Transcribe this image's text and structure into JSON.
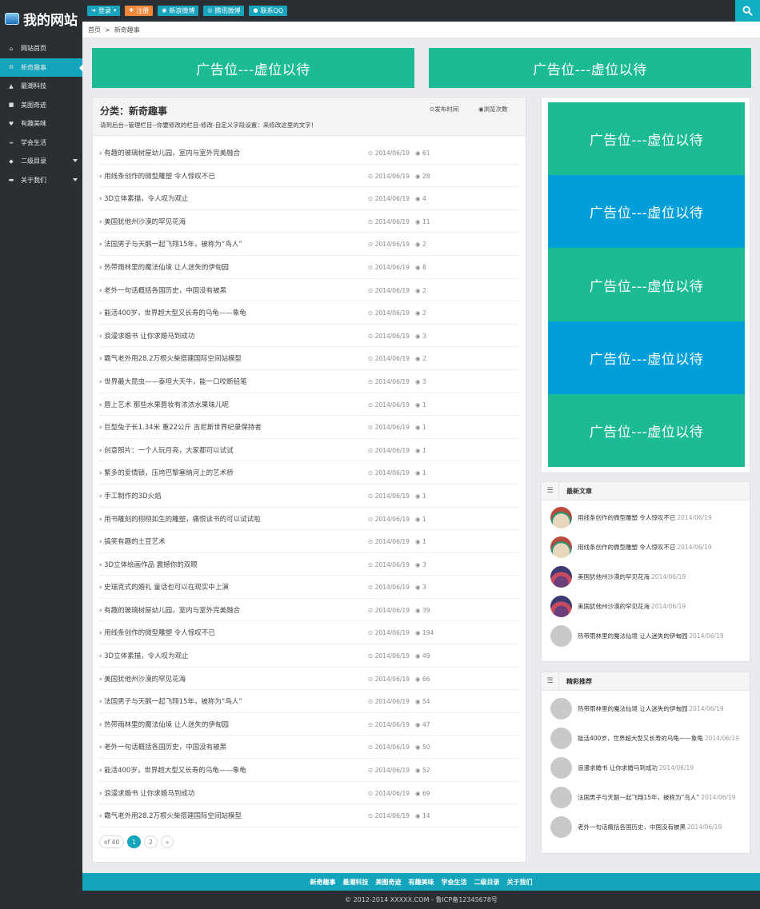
{
  "site": {
    "title": "我的网站"
  },
  "topbar": {
    "buttons": [
      {
        "label": "登录",
        "icon": "login-icon"
      },
      {
        "label": "注册",
        "icon": "user-icon"
      },
      {
        "label": "新浪微博",
        "icon": "weibo-icon"
      },
      {
        "label": "腾讯微博",
        "icon": "tencent-weibo-icon"
      },
      {
        "label": "联系QQ",
        "icon": "chat-icon"
      }
    ]
  },
  "sidebar": {
    "items": [
      {
        "label": "网站首页",
        "icon": "home-icon"
      },
      {
        "label": "新奇趣事",
        "icon": "gear-icon"
      },
      {
        "label": "最潮科技",
        "icon": "flask-icon"
      },
      {
        "label": "美图奇迹",
        "icon": "camera-icon"
      },
      {
        "label": "有趣美味",
        "icon": "thumbs-up-icon"
      },
      {
        "label": "学会生活",
        "icon": "coffee-icon"
      },
      {
        "label": "二级目录",
        "icon": "diamond-icon"
      },
      {
        "label": "关于我们",
        "icon": "folder-icon"
      }
    ]
  },
  "breadcrumb": {
    "home": "首页",
    "sep": ">",
    "current": "新奇趣事"
  },
  "ads": {
    "label": "广告位---虚位以待"
  },
  "category": {
    "title": "分类：新奇趣事",
    "desc": "请到后台--管理栏目--你要修改的栏目-修改-自定义字段设置：来修改这里的文字！",
    "sort_time": "发布时间",
    "sort_views": "浏览次数"
  },
  "articles": [
    {
      "title": "有趣的玻璃树屋幼儿园，室内与室外完美融合",
      "date": "2014/06/19",
      "views": "61"
    },
    {
      "title": "用线条创作的微型雕塑 令人惊叹不已",
      "date": "2014/06/19",
      "views": "28"
    },
    {
      "title": "3D立体素描，令人叹为观止",
      "date": "2014/06/19",
      "views": "4"
    },
    {
      "title": "美国犹他州沙漠的罕见花海",
      "date": "2014/06/19",
      "views": "11"
    },
    {
      "title": "法国男子与天鹅一起飞翔15年，被称为“鸟人”",
      "date": "2014/06/19",
      "views": "2"
    },
    {
      "title": "热带雨林里的魔法仙境 让人迷失的伊甸园",
      "date": "2014/06/19",
      "views": "8"
    },
    {
      "title": "老外一句话概括各国历史，中国没有被黑",
      "date": "2014/06/19",
      "views": "2"
    },
    {
      "title": "能活400岁，世界超大型又长寿的乌龟——象龟",
      "date": "2014/06/19",
      "views": "2"
    },
    {
      "title": "浪漫求婚书 让你求婚马到成功",
      "date": "2014/06/19",
      "views": "3"
    },
    {
      "title": "霸气老外用28.2万根火柴搭建国际空间站模型",
      "date": "2014/06/19",
      "views": "2"
    },
    {
      "title": "世界最大昆虫——泰坦大天牛，能一口咬断铅笔",
      "date": "2014/06/19",
      "views": "3"
    },
    {
      "title": "唇上艺术 那些水果唇妆有浓浓水果味儿呢",
      "date": "2014/06/19",
      "views": "1"
    },
    {
      "title": "巨型兔子长1.34米 重22公斤 吉尼斯世界纪录保持者",
      "date": "2014/06/19",
      "views": "1"
    },
    {
      "title": "创意照片：一个人玩月亮，大家都可以试试",
      "date": "2014/06/19",
      "views": "1"
    },
    {
      "title": "繁多的爱情锁，压垮巴黎塞纳河上的艺术桥",
      "date": "2014/06/19",
      "views": "1"
    },
    {
      "title": "手工制作的3D火焰",
      "date": "2014/06/19",
      "views": "1"
    },
    {
      "title": "用书雕刻的栩栩如生的雕塑，痛恨读书的可以试试啦",
      "date": "2014/06/19",
      "views": "1"
    },
    {
      "title": "搞笑有趣的土豆艺术",
      "date": "2014/06/19",
      "views": "1"
    },
    {
      "title": "3D立体绘画作品 震撼你的双眼",
      "date": "2014/06/19",
      "views": "3"
    },
    {
      "title": "史瑞克式的婚礼 童话也可以在现实中上演",
      "date": "2014/06/19",
      "views": "3"
    },
    {
      "title": "有趣的玻璃树屋幼儿园，室内与室外完美融合",
      "date": "2014/06/19",
      "views": "39"
    },
    {
      "title": "用线条创作的微型雕塑 令人惊叹不已",
      "date": "2014/06/19",
      "views": "194"
    },
    {
      "title": "3D立体素描，令人叹为观止",
      "date": "2014/06/19",
      "views": "49"
    },
    {
      "title": "美国犹他州沙漠的罕见花海",
      "date": "2014/06/19",
      "views": "66"
    },
    {
      "title": "法国男子与天鹅一起飞翔15年，被称为“鸟人”",
      "date": "2014/06/19",
      "views": "54"
    },
    {
      "title": "热带雨林里的魔法仙境 让人迷失的伊甸园",
      "date": "2014/06/19",
      "views": "47"
    },
    {
      "title": "老外一句话概括各国历史，中国没有被黑",
      "date": "2014/06/19",
      "views": "50"
    },
    {
      "title": "能活400岁，世界超大型又长寿的乌龟——象龟",
      "date": "2014/06/19",
      "views": "52"
    },
    {
      "title": "浪漫求婚书 让你求婚马到成功",
      "date": "2014/06/19",
      "views": "69"
    },
    {
      "title": "霸气老外用28.2万根火柴搭建国际空间站模型",
      "date": "2014/06/19",
      "views": "14"
    }
  ],
  "pager": {
    "total": "of 40",
    "pages": [
      "1",
      "2"
    ],
    "next": "»"
  },
  "latest": {
    "title": "最新文章",
    "items": [
      {
        "title": "用线条创作的微型雕塑 令人惊叹不已",
        "date": "2014/06/19",
        "thumb": "a"
      },
      {
        "title": "用线条创作的微型雕塑 令人惊叹不已",
        "date": "2014/06/19",
        "thumb": "a"
      },
      {
        "title": "美国犹他州沙漠的罕见花海",
        "date": "2014/06/19",
        "thumb": "b"
      },
      {
        "title": "美国犹他州沙漠的罕见花海",
        "date": "2014/06/19",
        "thumb": "b"
      },
      {
        "title": "热带雨林里的魔法仙境 让人迷失的伊甸园",
        "date": "2014/06/19",
        "thumb": "none"
      }
    ]
  },
  "featured": {
    "title": "精彩推荐",
    "items": [
      {
        "title": "热带雨林里的魔法仙境 让人迷失的伊甸园",
        "date": "2014/06/19"
      },
      {
        "title": "能活400岁，世界超大型又长寿的乌龟——象龟",
        "date": "2014/06/19"
      },
      {
        "title": "浪漫求婚书 让你求婚马到成功",
        "date": "2014/06/19"
      },
      {
        "title": "法国男子与天鹅一起飞翔15年，被称为“鸟人”",
        "date": "2014/06/19"
      },
      {
        "title": "老外一句话概括各国历史，中国没有被黑",
        "date": "2014/06/19"
      }
    ]
  },
  "footer": {
    "nav": [
      "新奇趣事",
      "最潮科技",
      "美图奇迹",
      "有趣美味",
      "学会生活",
      "二级目录",
      "关于我们"
    ],
    "copyright": "© 2012-2014 XXXXX.COM - 鲁ICP备12345678号"
  },
  "colors": {
    "teal": "#12a5bc",
    "green": "#1dbb94",
    "blue": "#009fd9",
    "dark": "#2a2f33",
    "orange": "#f0883a"
  }
}
